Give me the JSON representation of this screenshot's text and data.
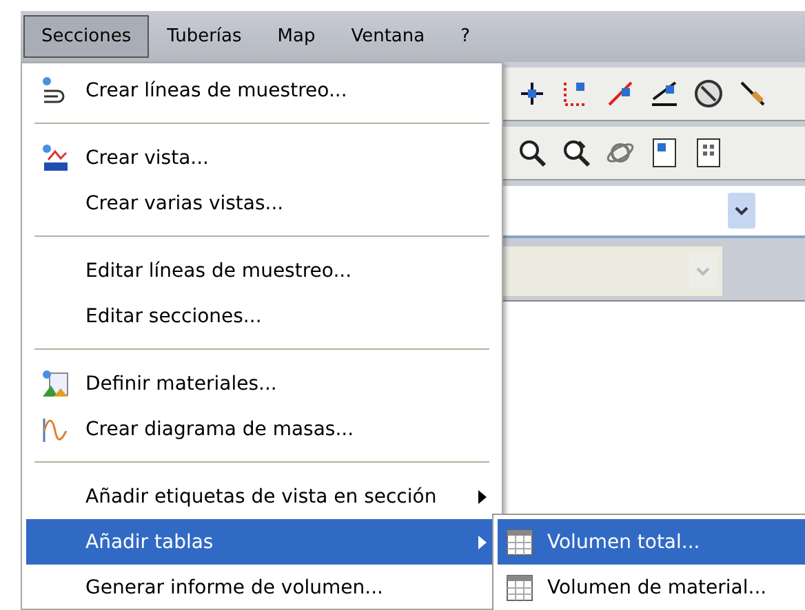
{
  "menubar": [
    {
      "label": "Secciones",
      "selected": true
    },
    {
      "label": "Tuberías",
      "selected": false
    },
    {
      "label": "Map",
      "selected": false
    },
    {
      "label": "Ventana",
      "selected": false
    },
    {
      "label": "?",
      "selected": false
    }
  ],
  "menu": [
    {
      "kind": "item",
      "label": "Crear líneas de muestreo...",
      "submenu": false,
      "selected": false
    },
    {
      "kind": "separator"
    },
    {
      "kind": "item",
      "label": "Crear vista...",
      "submenu": false,
      "selected": false
    },
    {
      "kind": "item",
      "label": "Crear varias vistas...",
      "submenu": false,
      "selected": false
    },
    {
      "kind": "separator"
    },
    {
      "kind": "item",
      "label": "Editar líneas de muestreo...",
      "submenu": false,
      "selected": false
    },
    {
      "kind": "item",
      "label": "Editar secciones...",
      "submenu": false,
      "selected": false
    },
    {
      "kind": "separator"
    },
    {
      "kind": "item",
      "label": "Definir materiales...",
      "submenu": false,
      "selected": false
    },
    {
      "kind": "item",
      "label": "Crear diagrama de masas...",
      "submenu": false,
      "selected": false
    },
    {
      "kind": "separator"
    },
    {
      "kind": "item",
      "label": "Añadir etiquetas de vista en sección",
      "submenu": true,
      "selected": false
    },
    {
      "kind": "item",
      "label": "Añadir tablas",
      "submenu": true,
      "selected": true
    },
    {
      "kind": "item",
      "label": "Generar informe de volumen...",
      "submenu": false,
      "selected": false
    }
  ],
  "submenu": [
    {
      "label": "Volumen total...",
      "selected": true
    },
    {
      "label": "Volumen de material...",
      "selected": false
    }
  ],
  "comboboxes": [
    {
      "disabled": false
    },
    {
      "disabled": true
    }
  ]
}
